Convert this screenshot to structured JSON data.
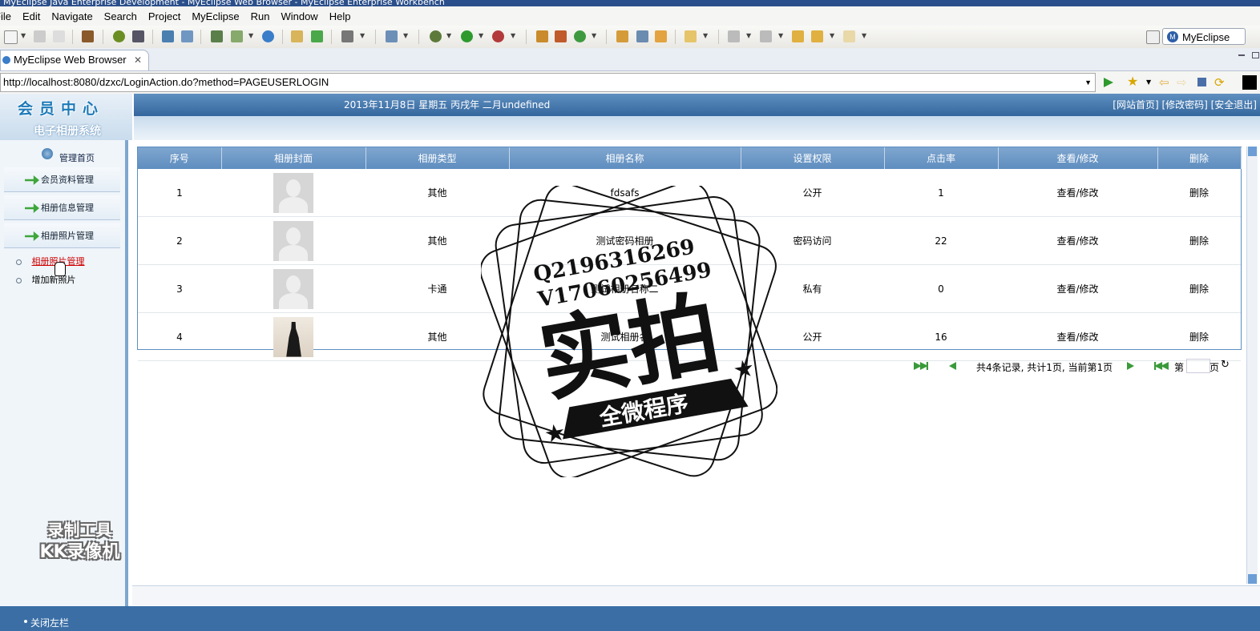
{
  "window": {
    "title": "MyEclipse Java Enterprise Development - MyEclipse Web Browser - MyEclipse Enterprise Workbench"
  },
  "menu": [
    "File",
    "Edit",
    "Navigate",
    "Search",
    "Project",
    "MyEclipse",
    "Run",
    "Window",
    "Help"
  ],
  "perspective": {
    "label": "MyEclipse J..."
  },
  "editor_tab": {
    "label": "MyEclipse Web Browser"
  },
  "browser": {
    "url": "http://localhost:8080/dzxc/LoginAction.do?method=PAGEUSERLOGIN"
  },
  "site": {
    "logo_title": "会员中心",
    "logo_subtitle": "电子相册系统",
    "date_text": "2013年11月8日 星期五 丙戌年 二月undefined",
    "top_links": "[网站首页] [修改密码] [安全退出]"
  },
  "nav": {
    "home": "管理首页",
    "sections": [
      "会员资料管理",
      "相册信息管理",
      "相册照片管理"
    ],
    "links": [
      "相册照片管理",
      "增加新照片"
    ]
  },
  "table": {
    "headers": [
      "序号",
      "相册封面",
      "相册类型",
      "相册名称",
      "设置权限",
      "点击率",
      "查看/修改",
      "删除"
    ],
    "rows": [
      {
        "no": "1",
        "type": "其他",
        "name": "fdsafs",
        "perm": "公开",
        "hits": "1",
        "edit": "查看/修改",
        "del": "删除"
      },
      {
        "no": "2",
        "type": "其他",
        "name": "测试密码相册",
        "perm": "密码访问",
        "hits": "22",
        "edit": "查看/修改",
        "del": "删除"
      },
      {
        "no": "3",
        "type": "卡通",
        "name": "测试相册名称二",
        "perm": "私有",
        "hits": "0",
        "edit": "查看/修改",
        "del": "删除"
      },
      {
        "no": "4",
        "type": "其他",
        "name": "测试相册名",
        "perm": "公开",
        "hits": "16",
        "edit": "查看/修改",
        "del": "删除"
      }
    ]
  },
  "pager": {
    "summary": "共4条记录, 共计1页, 当前第1页",
    "page_prefix": "第",
    "page_suffix": "页"
  },
  "footer": {
    "close_left": "关闭左栏"
  },
  "watermark": {
    "line1": "Q2196316269",
    "line2": "V17060256499",
    "main": "实拍",
    "banner": "全微程序",
    "recorder_line1": "录制工具",
    "recorder_line2": "KK录像机"
  }
}
